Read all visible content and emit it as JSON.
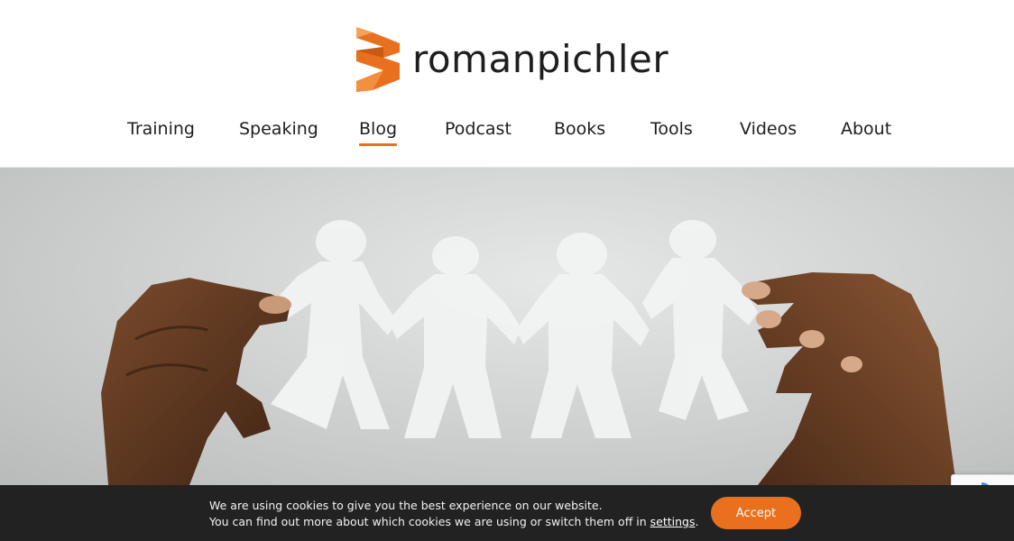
{
  "brand": {
    "name": "romanpichler",
    "accent_color": "#e8701e",
    "logo_icon": "stylized-r-logo-icon"
  },
  "nav": {
    "items": [
      {
        "label": "Training",
        "active": false
      },
      {
        "label": "Speaking",
        "active": false
      },
      {
        "label": "Blog",
        "active": true
      },
      {
        "label": "Podcast",
        "active": false
      },
      {
        "label": "Books",
        "active": false
      },
      {
        "label": "Tools",
        "active": false
      },
      {
        "label": "Videos",
        "active": false
      },
      {
        "label": "About",
        "active": false
      }
    ]
  },
  "hero": {
    "image": "hands-holding-paper-doll-chain-image"
  },
  "cookie_bar": {
    "line1": "We are using cookies to give you the best experience on our website.",
    "line2_prefix": "You can find out more about which cookies we are using or switch them off in ",
    "link_label": "settings",
    "line2_suffix": ".",
    "accept_label": "Accept",
    "background_color": "#222222"
  },
  "recaptcha": {
    "icon": "recaptcha-icon"
  }
}
